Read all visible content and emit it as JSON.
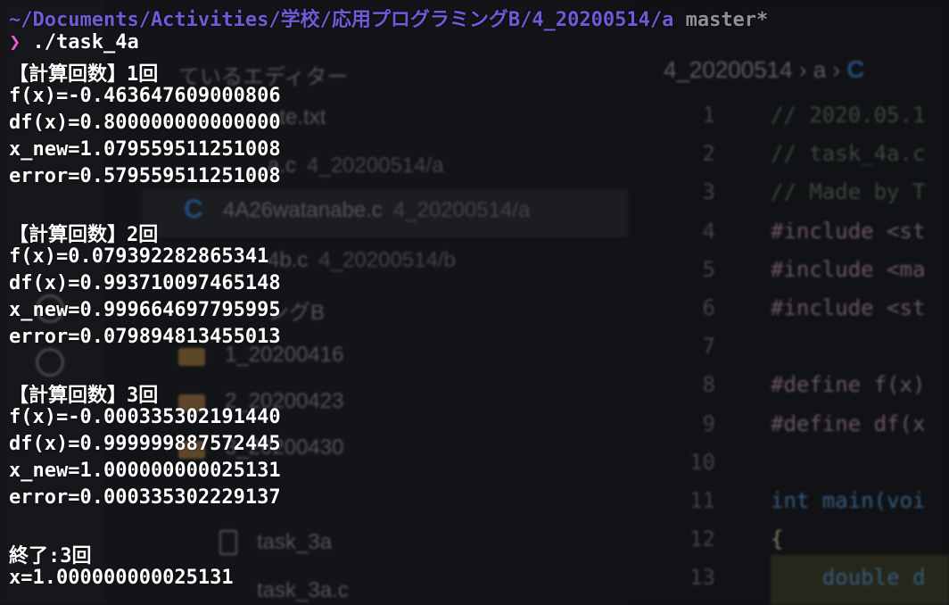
{
  "terminal": {
    "cwd": "~/Documents/Activities/学校/応用プログラミングB/4_20200514/a",
    "branch": "master*",
    "prompt_symbol": "❯",
    "command": "./task_4a",
    "iterations": [
      {
        "header": "【計算回数】1回",
        "fx": "f(x)=-0.463647609000806",
        "dfx": "df(x)=0.800000000000000",
        "x_new": "x_new=1.079559511251008",
        "error": "error=0.579559511251008"
      },
      {
        "header": "【計算回数】2回",
        "fx": "f(x)=0.079392282865341",
        "dfx": "df(x)=0.993710097465148",
        "x_new": "x_new=0.999664697795995",
        "error": "error=0.079894813455013"
      },
      {
        "header": "【計算回数】3回",
        "fx": "f(x)=-0.000335302191440",
        "dfx": "df(x)=0.999999887572445",
        "x_new": "x_new=1.000000000025131",
        "error": "error=0.000335302229137"
      }
    ],
    "finish": "終了:3回",
    "result": "x=1.000000000025131",
    "colors": {
      "path": "#6f5ad8",
      "branch": "#8f9196",
      "prompt": "#e05fd0",
      "text": "#ffffff"
    }
  },
  "background_editor": {
    "explorer_rows": [
      {
        "label": "ているエディター",
        "sub": ""
      },
      {
        "label": "ate.txt",
        "sub": ""
      },
      {
        "label": "a.c",
        "sub": "4_20200514/a"
      },
      {
        "label": "4A26watanabe.c",
        "sub": "4_20200514/a"
      },
      {
        "label": "4b.c",
        "sub": "4_20200514/b"
      },
      {
        "label": "ングB",
        "sub": ""
      },
      {
        "label": "1_20200416",
        "sub": ""
      },
      {
        "label": "2_20200423",
        "sub": ""
      },
      {
        "label": "3_20200430",
        "sub": ""
      },
      {
        "label": "task_3a",
        "sub": ""
      },
      {
        "label": "task_3a.c",
        "sub": ""
      }
    ],
    "breadcrumb": "4_20200514 › a ›",
    "line_numbers": [
      "1",
      "2",
      "3",
      "4",
      "5",
      "6",
      "7",
      "8",
      "9",
      "10",
      "11",
      "12",
      "13"
    ],
    "code_lines": [
      {
        "kind": "comment",
        "text": "// 2020.05.1"
      },
      {
        "kind": "comment",
        "text": "// task_4a.c"
      },
      {
        "kind": "comment",
        "text": "// Made by T"
      },
      {
        "kind": "include",
        "text": "#include <st"
      },
      {
        "kind": "include",
        "text": "#include <ma"
      },
      {
        "kind": "include",
        "text": "#include <st"
      },
      {
        "kind": "blank",
        "text": ""
      },
      {
        "kind": "define",
        "text": "#define f(x)"
      },
      {
        "kind": "define",
        "text": "#define df(x"
      },
      {
        "kind": "blank",
        "text": ""
      },
      {
        "kind": "main",
        "text": "int main(voi"
      },
      {
        "kind": "brace",
        "text": "{"
      },
      {
        "kind": "body",
        "text": "    double d"
      }
    ]
  }
}
